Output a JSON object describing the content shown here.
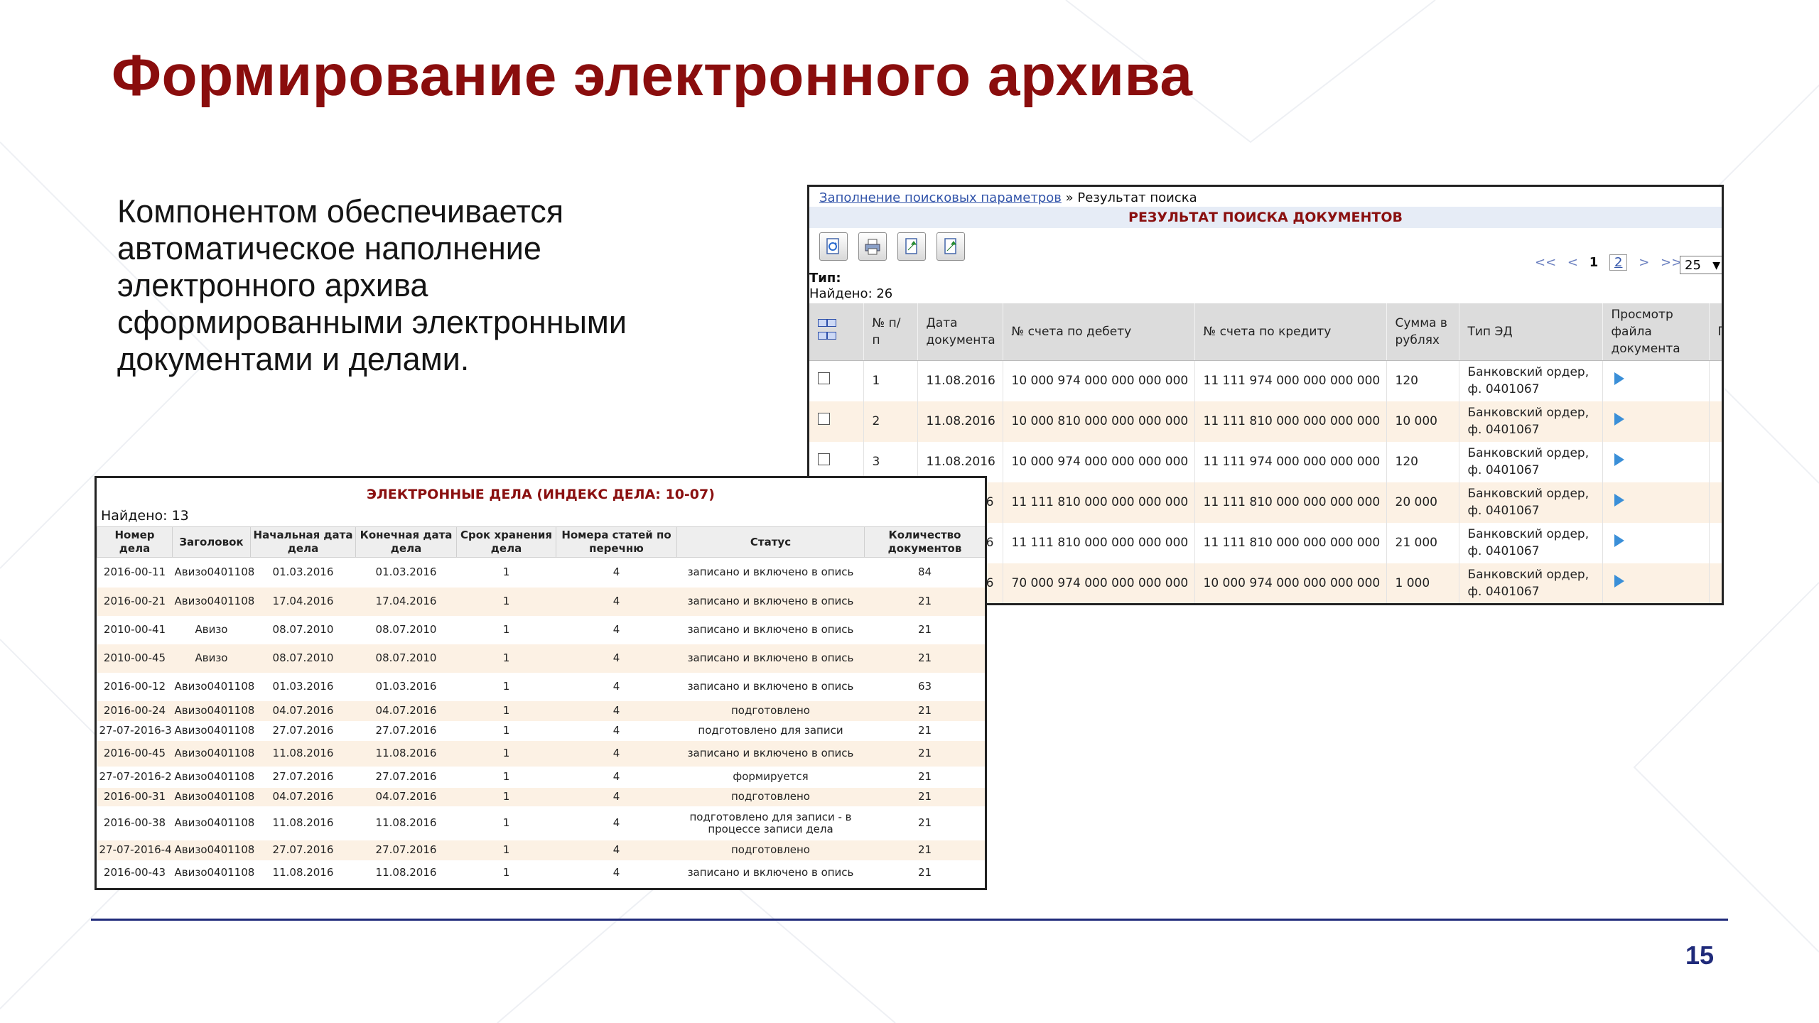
{
  "slide": {
    "title": "Формирование электронного архива",
    "body_lines": [
      "Компонентом обеспечивается",
      "автоматическое наполнение",
      "электронного архива",
      "сформированными электронными",
      "документами и делами."
    ],
    "page_number": "15"
  },
  "search_results": {
    "breadcrumb_link": "Заполнение поисковых параметров",
    "breadcrumb_separator": "»",
    "breadcrumb_current": "Результат поиска",
    "header": "РЕЗУЛЬТАТ ПОИСКА ДОКУМЕНТОВ",
    "toolbar": [
      "refresh-icon",
      "print-icon",
      "export-icon",
      "export-doc-icon"
    ],
    "pager": {
      "first": "<<",
      "prev": "<",
      "current": "1",
      "page2": "2",
      "next": ">",
      "last": ">>",
      "page_size": "25"
    },
    "type_label": "Тип:",
    "found_label": "Найдено: 26",
    "columns": [
      "",
      "№ п/п",
      "Дата документа",
      "№ счета по дебету",
      "№ счета по кредиту",
      "Сумма в рублях",
      "Тип ЭД",
      "Просмотр файла документа",
      "П в"
    ],
    "rows": [
      {
        "n": "1",
        "date": "11.08.2016",
        "debit": "10 000 974 000 000 000 000",
        "credit": "11 111 974 000 000 000 000",
        "sum": "120",
        "type": "Банковский ордер, ф. 0401067"
      },
      {
        "n": "2",
        "date": "11.08.2016",
        "debit": "10 000 810 000 000 000 000",
        "credit": "11 111 810 000 000 000 000",
        "sum": "10 000",
        "type": "Банковский ордер, ф. 0401067"
      },
      {
        "n": "3",
        "date": "11.08.2016",
        "debit": "10 000 974 000 000 000 000",
        "credit": "11 111 974 000 000 000 000",
        "sum": "120",
        "type": "Банковский ордер, ф. 0401067"
      },
      {
        "n": "",
        "date": "6",
        "debit": "11 111 810 000 000 000 000",
        "credit": "11 111 810 000 000 000 000",
        "sum": "20 000",
        "type": "Банковский ордер, ф. 0401067"
      },
      {
        "n": "",
        "date": "6",
        "debit": "11 111 810 000 000 000 000",
        "credit": "11 111 810 000 000 000 000",
        "sum": "21 000",
        "type": "Банковский ордер, ф. 0401067"
      },
      {
        "n": "",
        "date": "6",
        "debit": "70 000 974 000 000 000 000",
        "credit": "10 000 974 000 000 000 000",
        "sum": "1 000",
        "type": "Банковский ордер, ф. 0401067"
      }
    ]
  },
  "cases": {
    "header": "ЭЛЕКТРОННЫЕ ДЕЛА  (ИНДЕКС ДЕЛА:  10-07)",
    "found_label": "Найдено:  13",
    "columns": [
      "Номер дела",
      "Заголовок",
      "Начальная дата дела",
      "Конечная дата дела",
      "Срок хранения дела",
      "Номера статей по перечню",
      "Статус",
      "Количество документов"
    ],
    "rows": [
      {
        "num": "2016-00-11",
        "title": "Авизо0401108",
        "start": "01.03.2016",
        "end": "01.03.2016",
        "term": "1",
        "art": "4",
        "status": "записано и включено в опись",
        "count": "84"
      },
      {
        "num": "2016-00-21",
        "title": "Авизо0401108",
        "start": "17.04.2016",
        "end": "17.04.2016",
        "term": "1",
        "art": "4",
        "status": "записано и включено в опись",
        "count": "21"
      },
      {
        "num": "2010-00-41",
        "title": "Авизо",
        "start": "08.07.2010",
        "end": "08.07.2010",
        "term": "1",
        "art": "4",
        "status": "записано и включено в опись",
        "count": "21"
      },
      {
        "num": "2010-00-45",
        "title": "Авизо",
        "start": "08.07.2010",
        "end": "08.07.2010",
        "term": "1",
        "art": "4",
        "status": "записано и включено в опись",
        "count": "21"
      },
      {
        "num": "2016-00-12",
        "title": "Авизо0401108",
        "start": "01.03.2016",
        "end": "01.03.2016",
        "term": "1",
        "art": "4",
        "status": "записано и включено в опись",
        "count": "63"
      },
      {
        "num": "2016-00-24",
        "title": "Авизо0401108",
        "start": "04.07.2016",
        "end": "04.07.2016",
        "term": "1",
        "art": "4",
        "status": "подготовлено",
        "count": "21"
      },
      {
        "num": "27-07-2016-3",
        "title": "Авизо0401108",
        "start": "27.07.2016",
        "end": "27.07.2016",
        "term": "1",
        "art": "4",
        "status": "подготовлено для записи",
        "count": "21"
      },
      {
        "num": "2016-00-45",
        "title": "Авизо0401108",
        "start": "11.08.2016",
        "end": "11.08.2016",
        "term": "1",
        "art": "4",
        "status": "записано и включено в опись",
        "count": "21"
      },
      {
        "num": "27-07-2016-2",
        "title": "Авизо0401108",
        "start": "27.07.2016",
        "end": "27.07.2016",
        "term": "1",
        "art": "4",
        "status": "формируется",
        "count": "21"
      },
      {
        "num": "2016-00-31",
        "title": "Авизо0401108",
        "start": "04.07.2016",
        "end": "04.07.2016",
        "term": "1",
        "art": "4",
        "status": "подготовлено",
        "count": "21"
      },
      {
        "num": "2016-00-38",
        "title": "Авизо0401108",
        "start": "11.08.2016",
        "end": "11.08.2016",
        "term": "1",
        "art": "4",
        "status": "подготовлено для записи - в процессе записи дела",
        "count": "21"
      },
      {
        "num": "27-07-2016-4",
        "title": "Авизо0401108",
        "start": "27.07.2016",
        "end": "27.07.2016",
        "term": "1",
        "art": "4",
        "status": "подготовлено",
        "count": "21"
      },
      {
        "num": "2016-00-43",
        "title": "Авизо0401108",
        "start": "11.08.2016",
        "end": "11.08.2016",
        "term": "1",
        "art": "4",
        "status": "записано и включено в опись",
        "count": "21"
      }
    ]
  },
  "colors": {
    "title": "#8a0d0d",
    "footer_line": "#1f2a7a",
    "row_alt": "#fcf1e4",
    "link": "#3355aa"
  }
}
